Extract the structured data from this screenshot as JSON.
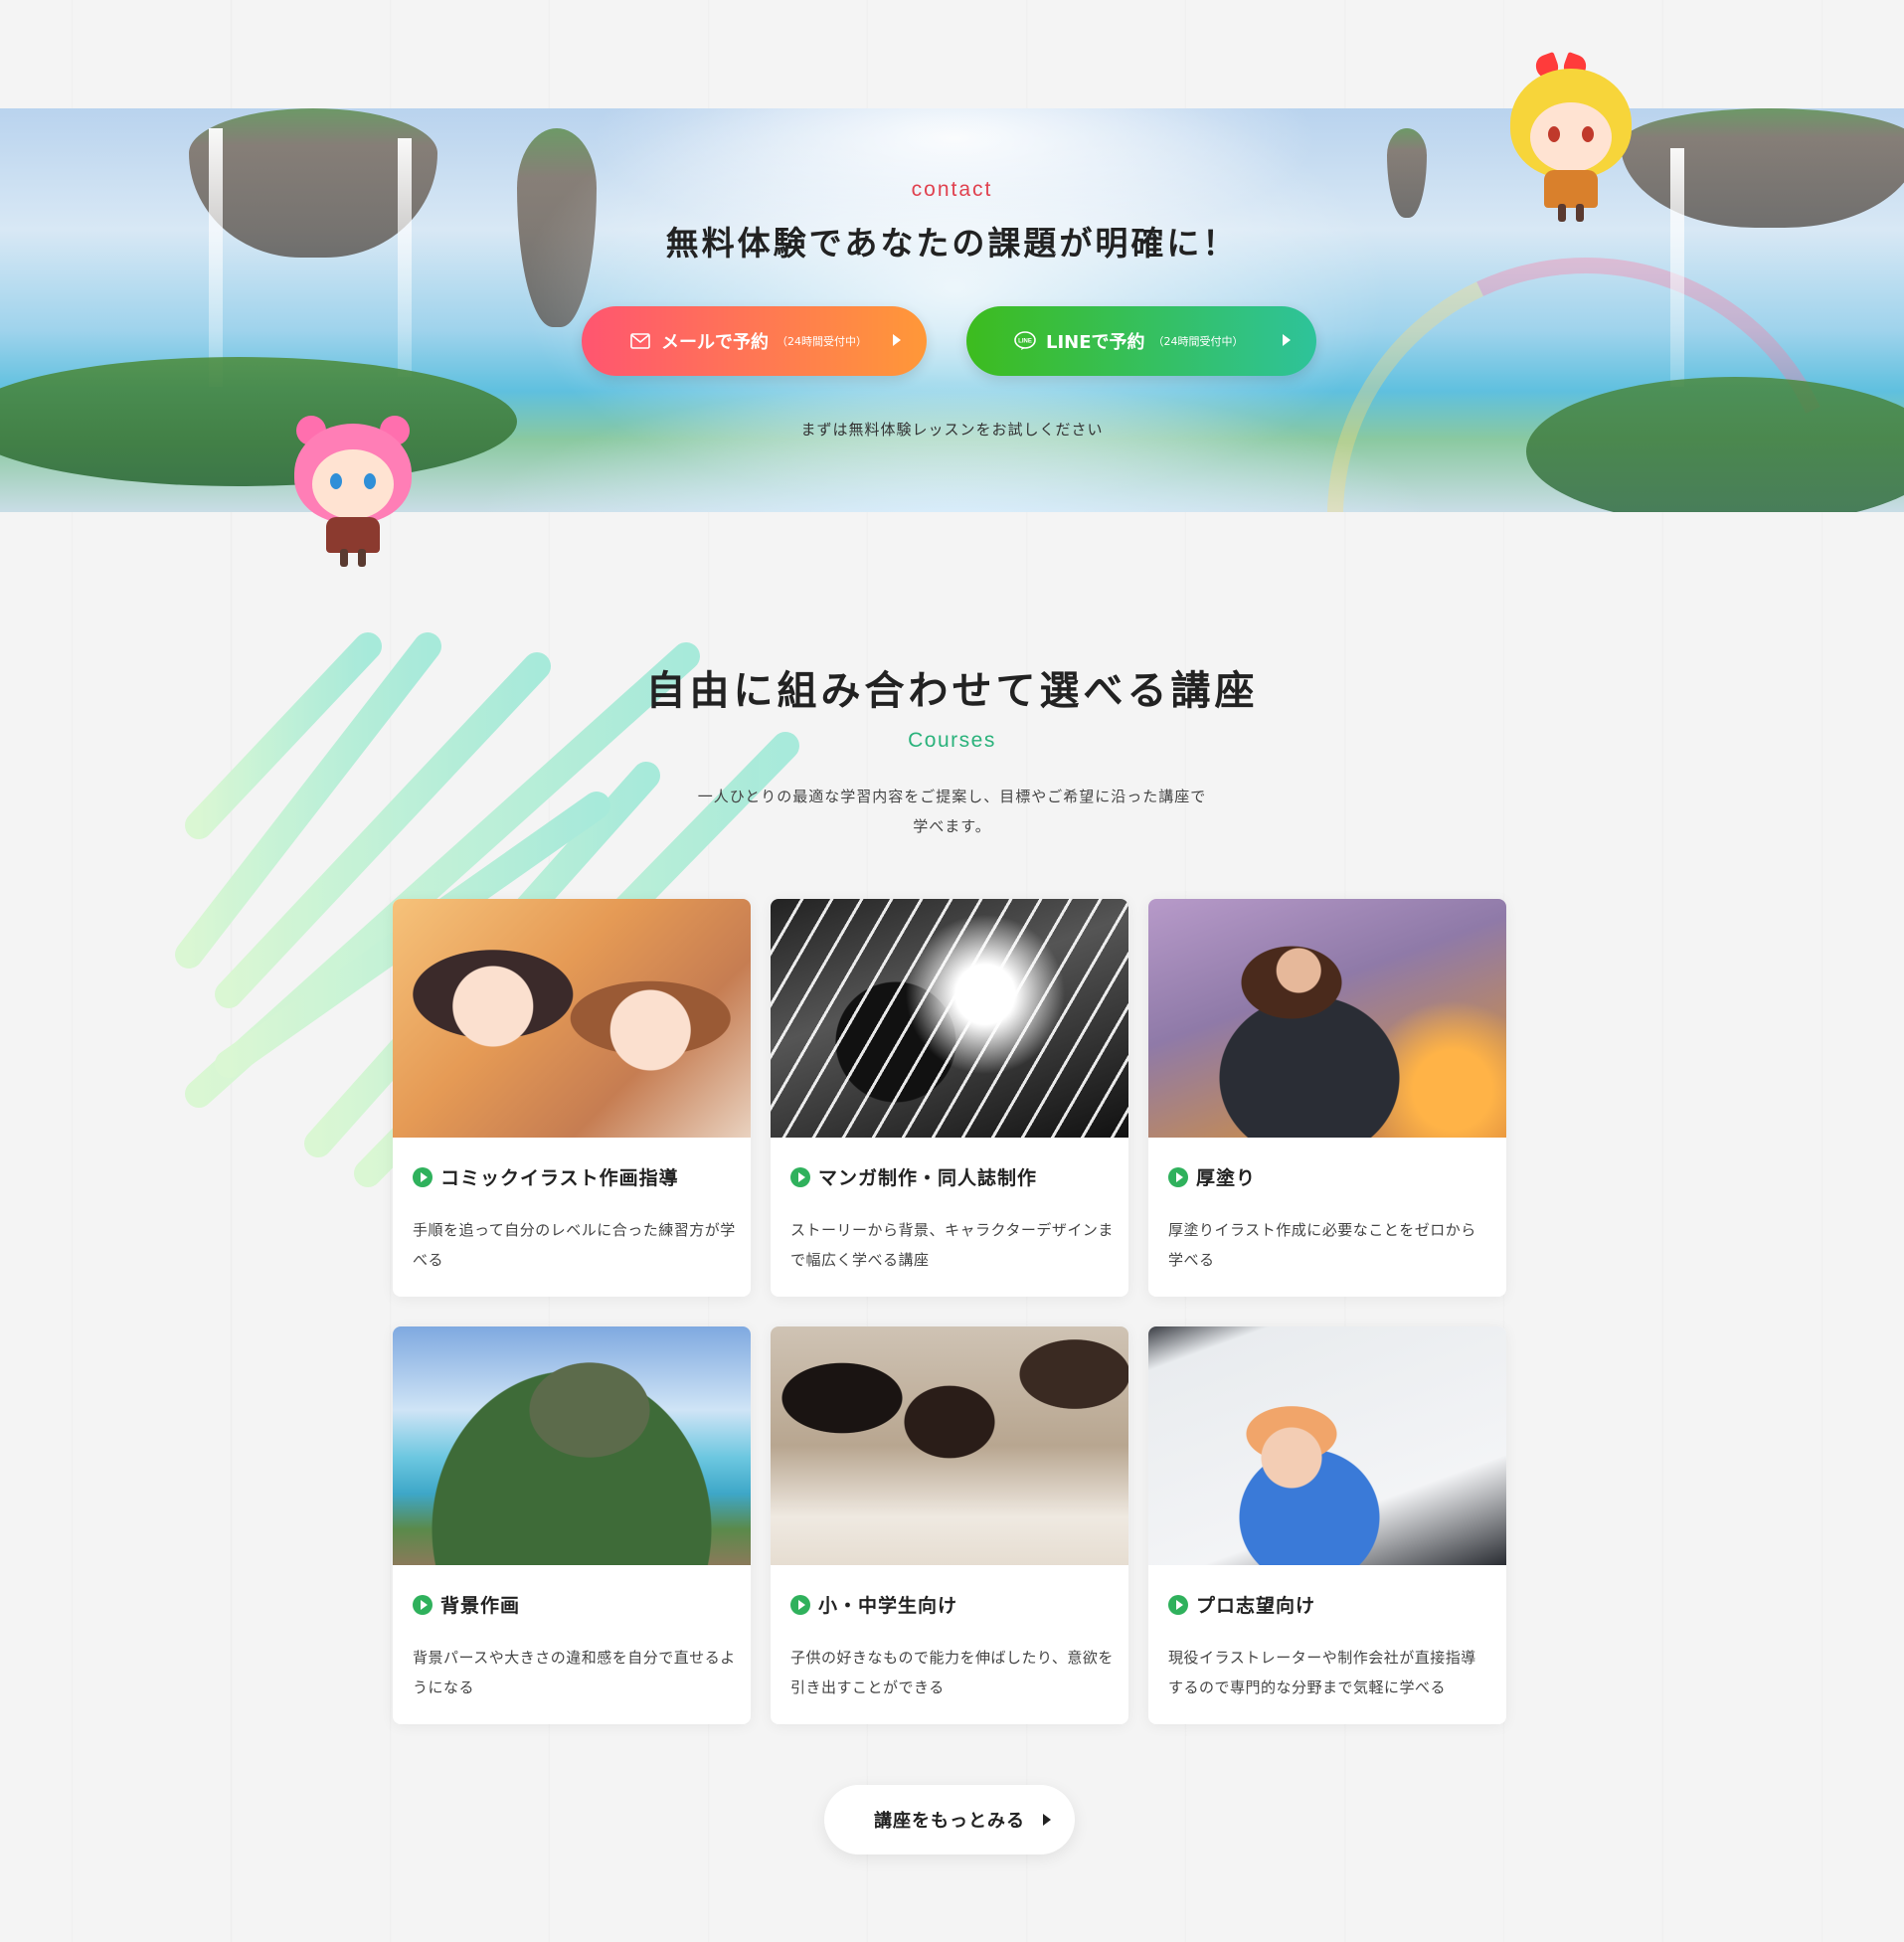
{
  "contact": {
    "label": "contact",
    "title": "無料体験であなたの課題が明確に！",
    "mail_button": {
      "label": "メールで予約",
      "note": "（24時間受付中）",
      "icon": "mail-icon"
    },
    "line_button": {
      "label": "LINEで予約",
      "note": "（24時間受付中）",
      "icon": "line-icon"
    },
    "note": "まずは無料体験レッスンをお試しください"
  },
  "courses": {
    "title": "自由に組み合わせて選べる講座",
    "subtitle": "Courses",
    "description": "一人ひとりの最適な学習内容をご提案し、目標やご希望に沿った講座で学べます。",
    "items": [
      {
        "title": "コミックイラスト作画指導",
        "desc": "手順を追って自分のレベルに合った練習方が学べる"
      },
      {
        "title": "マンガ制作・同人誌制作",
        "desc": "ストーリーから背景、キャラクターデザインまで幅広く学べる講座"
      },
      {
        "title": "厚塗り",
        "desc": "厚塗りイラスト作成に必要なことをゼロから学べる"
      },
      {
        "title": "背景作画",
        "desc": "背景パースや大きさの違和感を自分で直せるようになる"
      },
      {
        "title": "小・中学生向け",
        "desc": "子供の好きなもので能力を伸ばしたり、意欲を引き出すことができる"
      },
      {
        "title": "プロ志望向け",
        "desc": "現役イラストレーターや制作会社が直接指導するので専門的な分野まで気軽に学べる"
      }
    ],
    "more_button": "講座をもっとみる"
  },
  "colors": {
    "accent_red": "#e0414f",
    "accent_green": "#2ab27b",
    "mail_gradient": [
      "#ff5570",
      "#ff9838"
    ],
    "line_gradient": [
      "#3dbc1e",
      "#2ec39a"
    ]
  }
}
